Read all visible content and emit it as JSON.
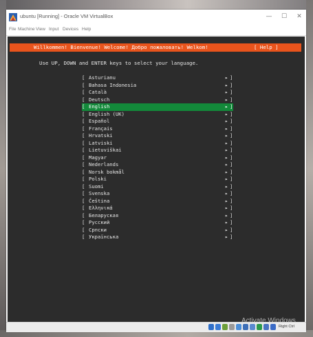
{
  "window": {
    "title": "ubuntu [Running] - Oracle VM VirtualBox",
    "controls": {
      "minimize": "—",
      "maximize": "☐",
      "close": "✕"
    }
  },
  "menu": [
    "File",
    "Machine",
    "View",
    "Input",
    "Devices",
    "Help"
  ],
  "installer": {
    "header_title": "Willkommen! Bienvenue! Welcome! Добро пожаловать! Welkom!",
    "help_label": "[ Help ]",
    "instructions": "Use UP, DOWN and ENTER keys to select your language.",
    "selected_language": "English",
    "languages": [
      "Asturianu",
      "Bahasa Indonesia",
      "Català",
      "Deutsch",
      "English",
      "English (UK)",
      "Español",
      "Français",
      "Hrvatski",
      "Latviski",
      "Lietuviškai",
      "Magyar",
      "Nederlands",
      "Norsk bokmål",
      "Polski",
      "Suomi",
      "Svenska",
      "Čeština",
      "Ελληνικά",
      "Беларуская",
      "Русский",
      "Српски",
      "Українська"
    ],
    "bracket_open": "[",
    "bracket_close": "]",
    "arrow": "▸"
  },
  "statusbar": {
    "watermark": "Activate Windows",
    "host_key": "Right Ctrl",
    "icon_colors": [
      "#2f6fc9",
      "#3a7bd5",
      "#6d9f3a",
      "#9a9a9a",
      "#4c8fd8",
      "#3d6fb8",
      "#5a8ad1",
      "#2b9a4b",
      "#4a74c2",
      "#3a6bc7"
    ]
  },
  "colors": {
    "header_orange": "#e9541c",
    "selection_green": "#13893a",
    "terminal_bg": "#2c2c2c"
  }
}
